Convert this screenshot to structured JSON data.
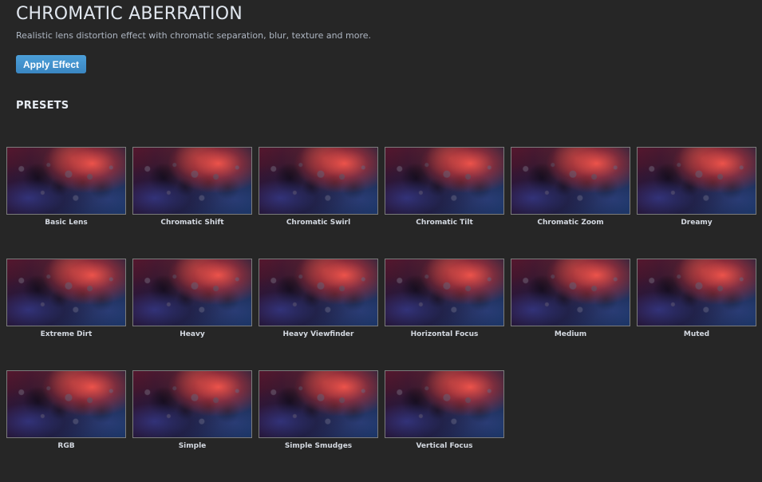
{
  "header": {
    "title": "CHROMATIC ABERRATION",
    "subtitle": "Realistic lens distortion effect with chromatic separation, blur, texture and more."
  },
  "toolbar": {
    "apply_label": "Apply Effect"
  },
  "presets": {
    "title": "PRESETS",
    "items": [
      {
        "label": "Basic Lens"
      },
      {
        "label": "Chromatic Shift"
      },
      {
        "label": "Chromatic Swirl"
      },
      {
        "label": "Chromatic Tilt"
      },
      {
        "label": "Chromatic Zoom"
      },
      {
        "label": "Dreamy"
      },
      {
        "label": "Extreme Dirt"
      },
      {
        "label": "Heavy"
      },
      {
        "label": "Heavy Viewfinder"
      },
      {
        "label": "Horizontal Focus"
      },
      {
        "label": "Medium"
      },
      {
        "label": "Muted"
      },
      {
        "label": "RGB"
      },
      {
        "label": "Simple"
      },
      {
        "label": "Simple Smudges"
      },
      {
        "label": "Vertical Focus"
      }
    ]
  },
  "colors": {
    "background": "#262626",
    "accent": "#3c8ac6",
    "text": "#d7dbe0"
  }
}
